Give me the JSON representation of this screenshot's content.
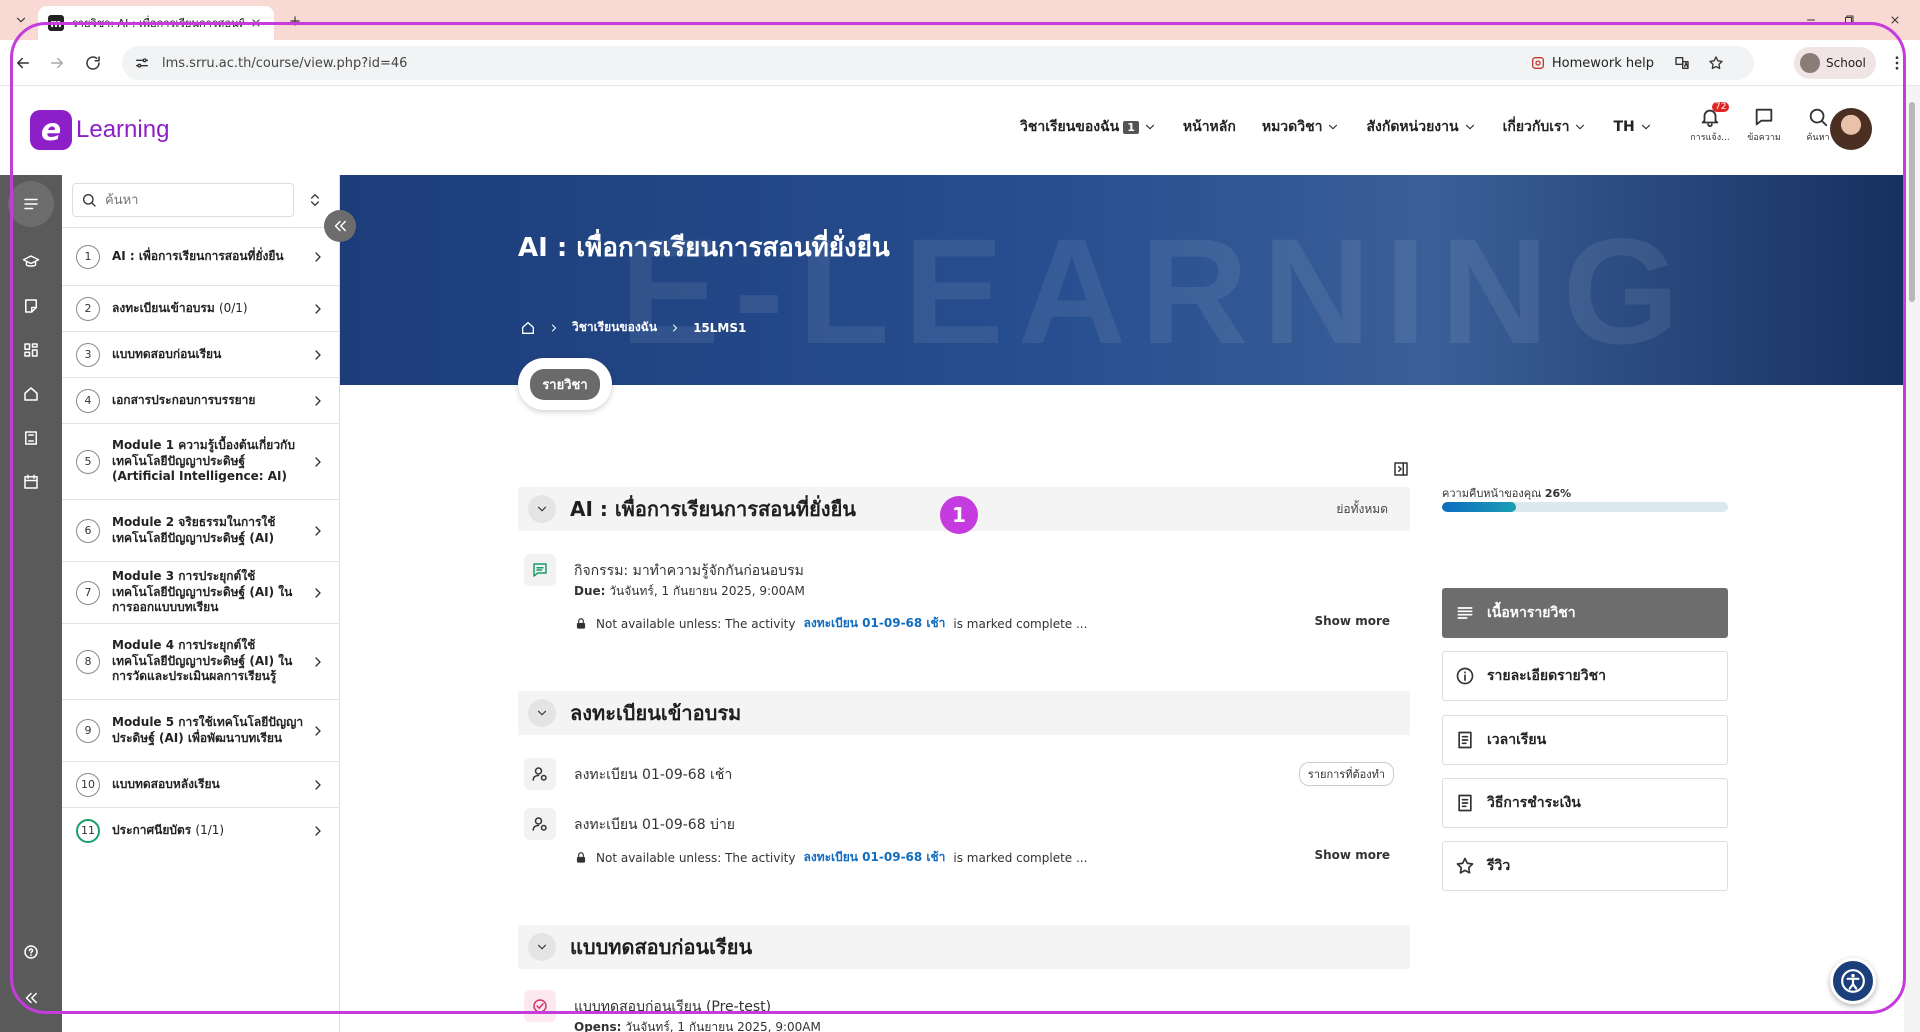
{
  "browser": {
    "tab_title": "รายวิชา: AI : เพื่อการเรียนการสอนที่ยั่งยืน",
    "url": "lms.srru.ac.th/course/view.php?id=46",
    "homework_help": "Homework help",
    "profile_label": "School"
  },
  "header": {
    "logo_text": "Learning",
    "nav": {
      "my_courses": "วิชาเรียนของฉัน",
      "my_courses_count": "1",
      "home": "หน้าหลัก",
      "categories": "หมวดวิชา",
      "departments": "สังกัดหน่วยงาน",
      "about": "เกี่ยวกับเรา",
      "lang": "TH"
    },
    "icons": {
      "notifications_label": "การแจ้ง...",
      "notifications_count": "72",
      "messages_label": "ข้อความ",
      "search_label": "ค้นหา"
    }
  },
  "course_index": {
    "search_placeholder": "ค้นหา",
    "items": [
      {
        "num": "1",
        "title": "AI : เพื่อการเรียนการสอนที่ยั่งยืน",
        "count": ""
      },
      {
        "num": "2",
        "title": "ลงทะเบียนเข้าอบรม",
        "count": "(0/1)"
      },
      {
        "num": "3",
        "title": "แบบทดสอบก่อนเรียน",
        "count": ""
      },
      {
        "num": "4",
        "title": "เอกสารประกอบการบรรยาย",
        "count": ""
      },
      {
        "num": "5",
        "title": "Module 1 ความรู้เบื้องต้นเกี่ยวกับเทคโนโลยีปัญญาประดิษฐ์ (Artificial Intelligence: AI)",
        "count": ""
      },
      {
        "num": "6",
        "title": "Module 2 จริยธรรมในการใช้เทคโนโลยีปัญญาประดิษฐ์ (AI)",
        "count": ""
      },
      {
        "num": "7",
        "title": "Module 3 การประยุกต์ใช้เทคโนโลยีปัญญาประดิษฐ์ (AI) ในการออกแบบบทเรียน",
        "count": ""
      },
      {
        "num": "8",
        "title": "Module 4 การประยุกต์ใช้เทคโนโลยีปัญญาประดิษฐ์ (AI) ในการวัดและประเมินผลการเรียนรู้",
        "count": ""
      },
      {
        "num": "9",
        "title": "Module 5 การใช้เทคโนโลยีปัญญาประดิษฐ์ (AI) เพื่อพัฒนาบทเรียน",
        "count": ""
      },
      {
        "num": "10",
        "title": "แบบทดสอบหลังเรียน",
        "count": ""
      },
      {
        "num": "11",
        "title": "ประกาศนียบัตร",
        "count": "(1/1)"
      }
    ]
  },
  "hero": {
    "watermark": "E-LEARNING",
    "title": "AI : เพื่อการเรียนการสอนที่ยั่งยืน",
    "breadcrumb": [
      "วิชาเรียนของฉัน",
      "15LMS1"
    ]
  },
  "course_tab": "รายวิชา",
  "sections": [
    {
      "title": "AI : เพื่อการเรียนการสอนที่ยั่งยืน",
      "collapse_all": "ย่อทั้งหมด",
      "activities": [
        {
          "name": "กิจกรรม: มาทำความรู้จักกันก่อนอบรม",
          "date_label": "Due:",
          "date_value": "วันจันทร์, 1 กันยายน 2025, 9:00AM",
          "restrict_prefix": "Not available unless: The activity",
          "restrict_link": "ลงทะเบียน 01-09-68 เช้า",
          "restrict_suffix": "is marked complete ...",
          "show_more": "Show more"
        }
      ]
    },
    {
      "title": "ลงทะเบียนเข้าอบรม",
      "activities": [
        {
          "name": "ลงทะเบียน 01-09-68 เช้า",
          "badge": "รายการที่ต้องทำ"
        },
        {
          "name": "ลงทะเบียน 01-09-68 บ่าย",
          "restrict_prefix": "Not available unless: The activity",
          "restrict_link": "ลงทะเบียน 01-09-68 เช้า",
          "restrict_suffix": "is marked complete ...",
          "show_more": "Show more"
        }
      ]
    },
    {
      "title": "แบบทดสอบก่อนเรียน",
      "activities": [
        {
          "name": "แบบทดสอบก่อนเรียน (Pre-test)",
          "date_label": "Opens:",
          "date_value": "วันจันทร์, 1 กันยายน 2025, 9:00AM"
        }
      ]
    }
  ],
  "progress": {
    "label": "ความคืบหน้าของคุณ",
    "percent_text": "26%",
    "value": 0.26
  },
  "side_menu": [
    {
      "label": "เนื้อหารายวิชา",
      "icon": "list-icon",
      "active": true
    },
    {
      "label": "รายละเอียดรายวิชา",
      "icon": "info-icon",
      "active": false
    },
    {
      "label": "เวลาเรียน",
      "icon": "document-icon",
      "active": false
    },
    {
      "label": "วิธีการชำระเงิน",
      "icon": "document-icon",
      "active": false
    },
    {
      "label": "รีวิว",
      "icon": "star-icon",
      "active": false
    }
  ],
  "step_marker": "1",
  "colors": {
    "brand": "#8d1fc9",
    "annotation": "#c53bdc",
    "link": "#0f6cbf",
    "complete": "#1a9e6a"
  }
}
